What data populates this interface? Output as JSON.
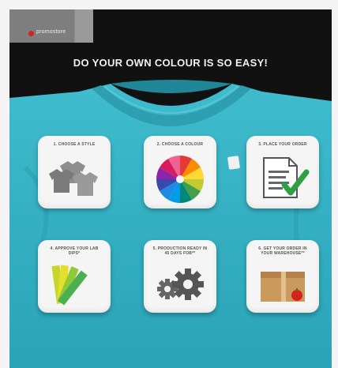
{
  "brand": {
    "name": "promostore"
  },
  "headline": "DO YOUR OWN COLOUR IS SO EASY!",
  "steps": [
    {
      "label": "1. CHOOSE A STYLE",
      "icon": "tshirt-stack-icon"
    },
    {
      "label": "2. CHOOSE A COLOUR",
      "icon": "color-wheel-icon"
    },
    {
      "label": "3. PLACE YOUR ORDER",
      "icon": "checked-document-icon"
    },
    {
      "label": "4. APPROVE YOUR LAB DIPS*",
      "icon": "color-swatches-icon"
    },
    {
      "label": "5. PRODUCTION READY IN 45 DAYS FOB**",
      "icon": "gears-icon"
    },
    {
      "label": "6. GET YOUR ORDER IN YOUR WAREHOUSE**",
      "icon": "shipping-box-icon"
    }
  ],
  "colors": {
    "shirt": "#36b3c7",
    "background": "#111111",
    "card": "#f5f5f5",
    "accent": "#d2231c"
  }
}
